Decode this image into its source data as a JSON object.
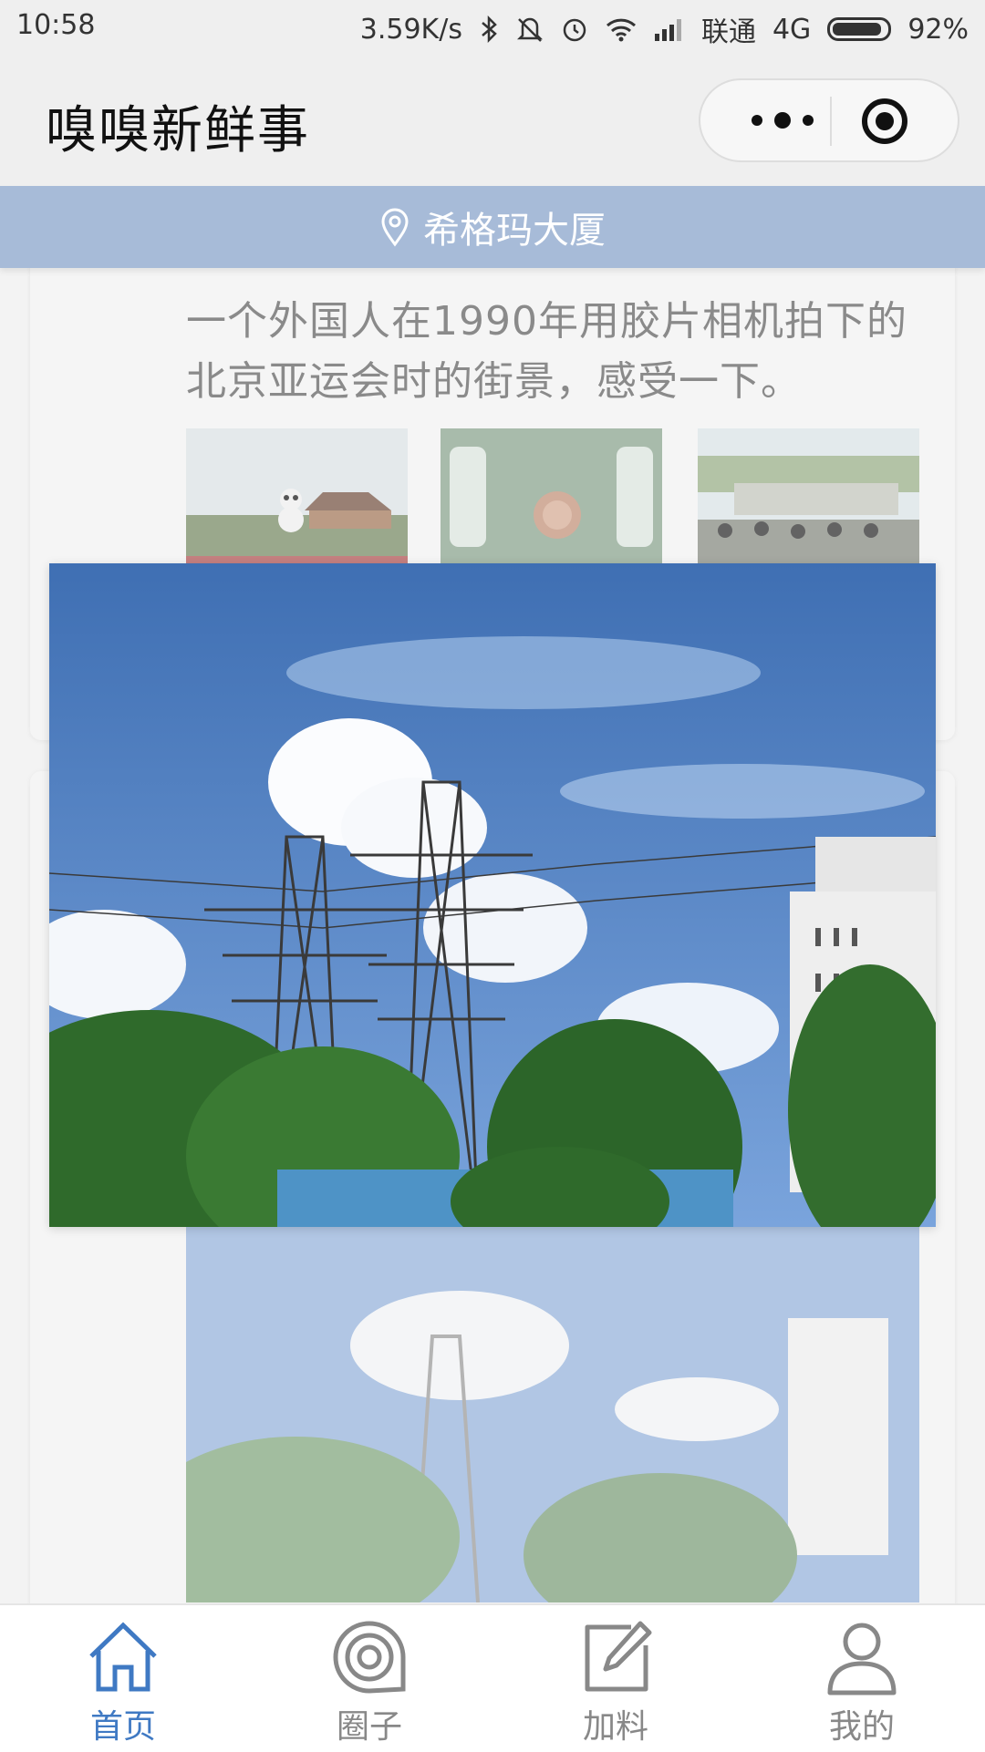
{
  "status_bar": {
    "time": "10:58",
    "speed": "3.59K/s",
    "carrier": "联通",
    "network": "4G",
    "battery": "92%",
    "battery_level": 0.92
  },
  "header": {
    "title": "嗅嗅新鲜事"
  },
  "location": {
    "name": "希格玛大厦",
    "icon": "location-pin-icon",
    "background": "#a7bbd8"
  },
  "post": {
    "text": "一个外国人在1990年用胶片相机拍下的北京亚运会时的街景，感受一下。"
  },
  "tabs": [
    {
      "label": "首页",
      "icon": "home-icon",
      "active": true
    },
    {
      "label": "圈子",
      "icon": "circle-icon",
      "active": false
    },
    {
      "label": "加料",
      "icon": "edit-icon",
      "active": false
    },
    {
      "label": "我的",
      "icon": "user-icon",
      "active": false
    }
  ],
  "colors": {
    "accent": "#3f79c3",
    "inactive": "#888888"
  }
}
